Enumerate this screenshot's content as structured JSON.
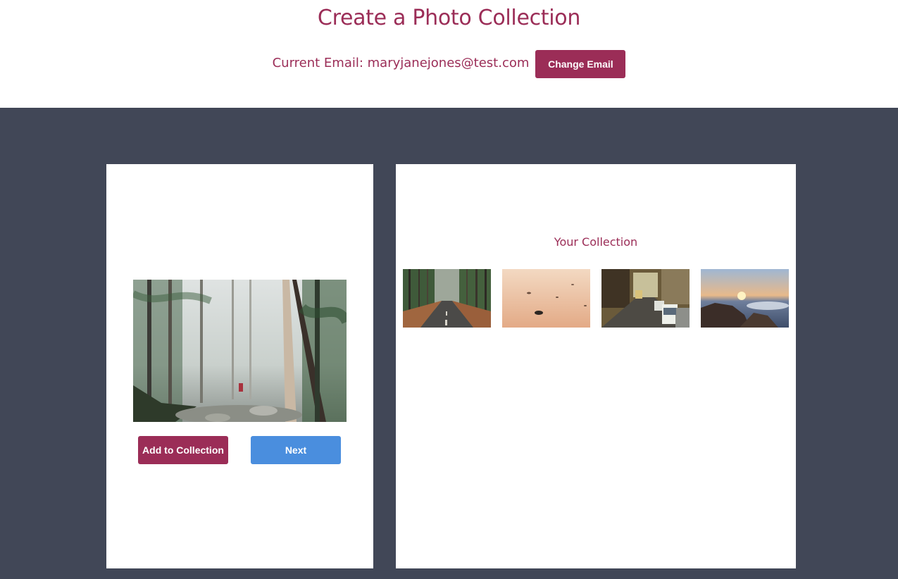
{
  "header": {
    "title": "Create a Photo Collection",
    "email_label": "Current Email: maryjanejones@test.com",
    "change_email_label": "Change Email"
  },
  "viewer": {
    "photo": "forest-photo",
    "add_label": "Add to Collection",
    "next_label": "Next"
  },
  "collection": {
    "title": "Your Collection",
    "thumbnails": [
      "tree-lined-road-photo",
      "sand-pebbles-photo",
      "city-street-photo",
      "ocean-sunset-photo"
    ]
  },
  "colors": {
    "accent": "#9b2d57",
    "next_button": "#4a8ede",
    "background": "#414757"
  }
}
